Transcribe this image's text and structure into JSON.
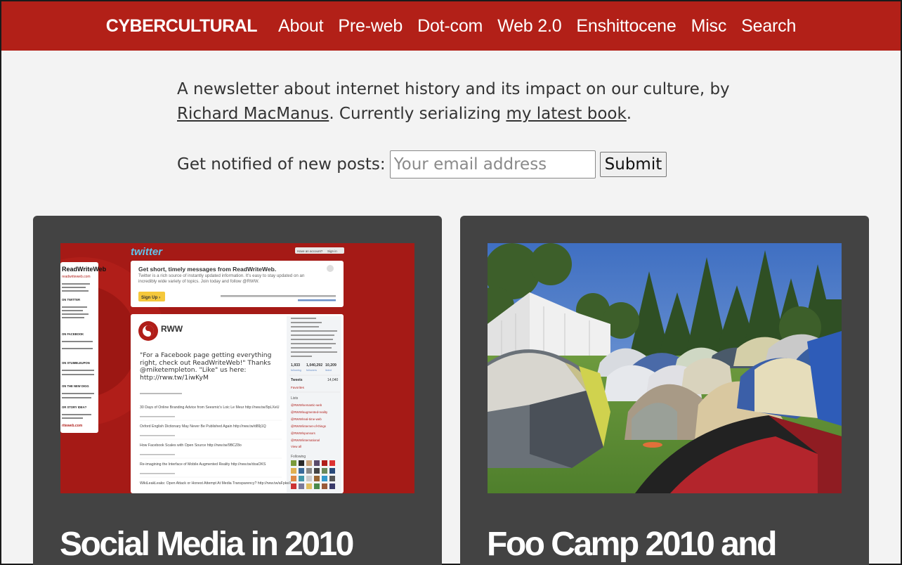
{
  "nav": {
    "brand": "CYBERCULTURAL",
    "links": [
      "About",
      "Pre-web",
      "Dot-com",
      "Web 2.0",
      "Enshittocene",
      "Misc",
      "Search"
    ]
  },
  "intro": {
    "text_before": "A newsletter about internet history and its impact on our culture, by ",
    "author_link": "Richard MacManus",
    "text_middle": ". Currently serializing ",
    "book_link": "my latest book",
    "text_after": "."
  },
  "signup": {
    "label": "Get notified of new posts:",
    "placeholder": "Your email address",
    "value": "",
    "submit_label": "Submit"
  },
  "colors": {
    "brand_red": "#b22018",
    "card_bg": "#434343",
    "page_bg": "#f3f3f3"
  },
  "posts": [
    {
      "title": "Social Media in 2010",
      "image": {
        "twitter_logo": "twitter",
        "account_prompt": "Have an account?",
        "sign_in": "Sign in",
        "sidebar_brand": "ReadWriteWeb",
        "sidebar_lines": [
          "readwriteweb.com",
          "ON TWITTER",
          "ON FACEBOOK",
          "ON STUMBLEUPON",
          "ON THE NEW DIGG",
          "OR STORY IDEA?",
          "riteweb.com"
        ],
        "banner_heading": "Get short, timely messages from ReadWriteWeb.",
        "banner_body": "Twitter is a rich source of instantly updated information. It's easy to stay updated on an incredibly wide variety of topics. Join today and follow @RWW.",
        "signup_button": "Sign Up ›",
        "profile_name": "RWW",
        "tweet": "\"For a Facebook page getting everything right, check out ReadWriteWeb!\" Thanks @miketempleton. \"Like\" us here: http://rww.tw/1iwKyM",
        "tweet_list": [
          "30 Days of Online Branding Advice from Seesmic's Loic Le Meur http://rww.tw/9pLXeU",
          "Oxford English Dictionary May Never Be Published Again http://rww.tw/d89j1Q",
          "How Facebook Scales with Open Source http://rww.tw/9BCZ8o",
          "Re-imagining the Interface of Mobile Augmented Reality http://rww.tw/doaOKS",
          "WikiLeakLeaks: Open Attack or Honest Attempt At Media Transparency? http://rww.tw/aFpkeX"
        ],
        "stats": [
          "1,933",
          "1,040,292",
          "10,209"
        ],
        "stat_labels": [
          "following",
          "followers",
          "listed"
        ],
        "tweets_label": "Tweets",
        "tweets_count": "14,040",
        "favorites": "Favorites",
        "lists_heading": "Lists",
        "lists": [
          "@RWW/semantic-web",
          "@RWW/augmented-reality",
          "@RWW/real-time-web",
          "@RWW/internet-of-things",
          "@RWW/sponsors",
          "@RWW/international",
          "View all"
        ],
        "following_heading": "Following"
      }
    },
    {
      "title": "Foo Camp 2010 and"
    }
  ]
}
